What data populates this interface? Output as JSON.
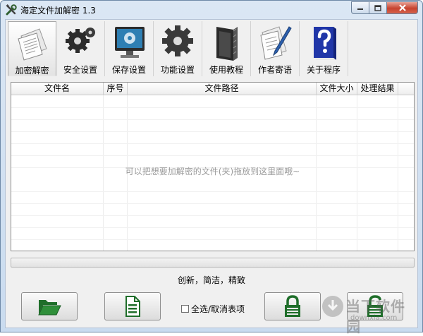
{
  "window": {
    "title": "海定文件加解密 1.3",
    "title_icon": "tools-icon",
    "controls": [
      "minimize-icon",
      "maximize-icon",
      "close-icon"
    ]
  },
  "toolbar": {
    "items": [
      {
        "label": "加密解密",
        "icon": "documents-icon",
        "active": true
      },
      {
        "label": "安全设置",
        "icon": "gears-icon",
        "active": false
      },
      {
        "label": "保存设置",
        "icon": "monitor-settings-icon",
        "active": false
      },
      {
        "label": "功能设置",
        "icon": "gear-icon",
        "active": false
      },
      {
        "label": "使用教程",
        "icon": "book-icon",
        "active": false
      },
      {
        "label": "作者寄语",
        "icon": "document-pen-icon",
        "active": false
      },
      {
        "label": "关于程序",
        "icon": "question-book-icon",
        "active": false
      }
    ]
  },
  "table": {
    "columns": [
      "文件名",
      "序号",
      "文件路径",
      "文件大小",
      "处理结果"
    ],
    "rows": [],
    "empty_hint": "可以把想要加解密的文件(夹)拖放到这里面哦~"
  },
  "status": {
    "progress": 0,
    "slogan": "创新，简洁，精致"
  },
  "actions": {
    "open_folder_icon": "folder-open-icon",
    "open_file_icon": "file-list-icon",
    "select_all_label": "全选/取消表项",
    "select_all_checked": false,
    "encrypt_icon": "lock-icon",
    "decrypt_icon": "unlock-icon"
  },
  "watermark": {
    "text": "当下软件园",
    "url_text": "downxia.com"
  },
  "colors": {
    "accent_green": "#1f7a2a",
    "titlebar": "#c9dbef",
    "close_button": "#c7432f"
  }
}
